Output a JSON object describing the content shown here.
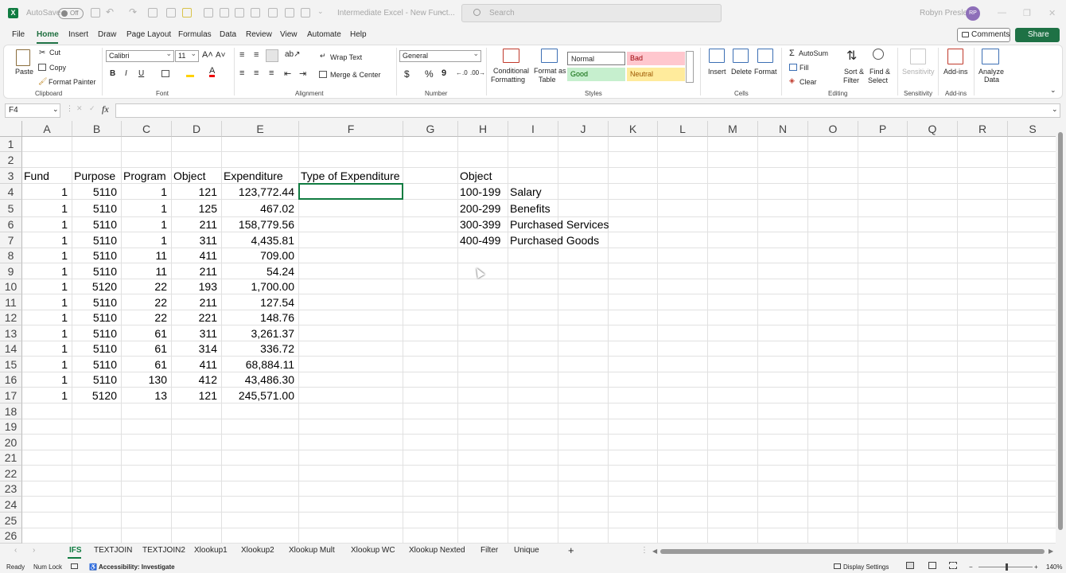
{
  "titlebar": {
    "autosave_label": "AutoSave",
    "autosave_state": "Off",
    "doc_title": "Intermediate Excel - New Funct...",
    "search_placeholder": "Search",
    "user_name": "Robyn Presley",
    "user_initials": "RP"
  },
  "menu": [
    "File",
    "Home",
    "Insert",
    "Draw",
    "Page Layout",
    "Formulas",
    "Data",
    "Review",
    "View",
    "Automate",
    "Help"
  ],
  "menu_active": "Home",
  "comments_label": "Comments",
  "share_label": "Share",
  "ribbon": {
    "clipboard": {
      "paste": "Paste",
      "cut": "Cut",
      "copy": "Copy",
      "format_painter": "Format Painter",
      "group": "Clipboard"
    },
    "font": {
      "name": "Calibri",
      "size": "11",
      "bold": "B",
      "italic": "I",
      "underline": "U",
      "group": "Font"
    },
    "alignment": {
      "wrap": "Wrap Text",
      "merge": "Merge & Center",
      "group": "Alignment"
    },
    "number": {
      "format": "General",
      "currency": "$",
      "percent": "%",
      "comma": "9",
      "group": "Number"
    },
    "styles": {
      "conditional": "Conditional",
      "conditional2": "Formatting",
      "format_as": "Format as",
      "format_as2": "Table",
      "normal": "Normal",
      "bad": "Bad",
      "good": "Good",
      "neutral": "Neutral",
      "group": "Styles"
    },
    "cells": {
      "insert": "Insert",
      "delete": "Delete",
      "format": "Format",
      "group": "Cells"
    },
    "editing": {
      "autosum": "AutoSum",
      "fill": "Fill",
      "clear": "Clear",
      "sort": "Sort &",
      "sort2": "Filter",
      "find": "Find &",
      "find2": "Select",
      "group": "Editing"
    },
    "sensitivity": {
      "label": "Sensitivity",
      "group": "Sensitivity"
    },
    "addins": {
      "label": "Add-ins",
      "group": "Add-ins"
    },
    "analyze": {
      "label": "Analyze",
      "label2": "Data"
    }
  },
  "name_box": "F4",
  "fx_label": "fx",
  "columns": [
    "A",
    "B",
    "C",
    "D",
    "E",
    "F",
    "G",
    "H",
    "I",
    "J",
    "K",
    "L",
    "M",
    "N",
    "O",
    "P",
    "Q",
    "R",
    "S"
  ],
  "rows": [
    "1",
    "2",
    "3",
    "4",
    "5",
    "6",
    "7",
    "8",
    "9",
    "10",
    "11",
    "12",
    "13",
    "14",
    "15",
    "16",
    "17",
    "18",
    "19",
    "20",
    "21",
    "22",
    "23",
    "24",
    "25",
    "26"
  ],
  "headers": {
    "fund": "Fund",
    "purpose": "Purpose",
    "program": "Program",
    "object": "Object",
    "expenditure": "Expenditure",
    "type": "Type of Expenditure"
  },
  "data_rows": [
    {
      "fund": "1",
      "purpose": "5110",
      "program": "1",
      "object": "121",
      "exp": "123,772.44"
    },
    {
      "fund": "1",
      "purpose": "5110",
      "program": "1",
      "object": "125",
      "exp": "467.02"
    },
    {
      "fund": "1",
      "purpose": "5110",
      "program": "1",
      "object": "211",
      "exp": "158,779.56"
    },
    {
      "fund": "1",
      "purpose": "5110",
      "program": "1",
      "object": "311",
      "exp": "4,435.81"
    },
    {
      "fund": "1",
      "purpose": "5110",
      "program": "11",
      "object": "411",
      "exp": "709.00"
    },
    {
      "fund": "1",
      "purpose": "5110",
      "program": "11",
      "object": "211",
      "exp": "54.24"
    },
    {
      "fund": "1",
      "purpose": "5120",
      "program": "22",
      "object": "193",
      "exp": "1,700.00"
    },
    {
      "fund": "1",
      "purpose": "5110",
      "program": "22",
      "object": "211",
      "exp": "127.54"
    },
    {
      "fund": "1",
      "purpose": "5110",
      "program": "22",
      "object": "221",
      "exp": "148.76"
    },
    {
      "fund": "1",
      "purpose": "5110",
      "program": "61",
      "object": "311",
      "exp": "3,261.37"
    },
    {
      "fund": "1",
      "purpose": "5110",
      "program": "61",
      "object": "314",
      "exp": "336.72"
    },
    {
      "fund": "1",
      "purpose": "5110",
      "program": "61",
      "object": "411",
      "exp": "68,884.11"
    },
    {
      "fund": "1",
      "purpose": "5110",
      "program": "130",
      "object": "412",
      "exp": "43,486.30"
    },
    {
      "fund": "1",
      "purpose": "5120",
      "program": "13",
      "object": "121",
      "exp": "245,571.00"
    }
  ],
  "lookup": {
    "header": "Object",
    "rows": [
      {
        "range": "100-199",
        "type": "Salary"
      },
      {
        "range": "200-299",
        "type": "Benefits"
      },
      {
        "range": "300-399",
        "type": "Purchased Services"
      },
      {
        "range": "400-499",
        "type": "Purchased Goods"
      }
    ]
  },
  "sheet_tabs": [
    "IFS",
    "TEXTJOIN",
    "TEXTJOIN2",
    "Xlookup1",
    "Xlookup2",
    "Xlookup Mult",
    "Xlookup WC",
    "Xlookup Nexted",
    "Filter",
    "Unique"
  ],
  "sheet_active": "IFS",
  "status": {
    "ready": "Ready",
    "numlock": "Num Lock",
    "accessibility": "Accessibility: Investigate",
    "display": "Display Settings",
    "zoom": "140%"
  },
  "colors": {
    "excel_green": "#107c41",
    "bad_bg": "#ffc7ce",
    "good_bg": "#c6efce",
    "neutral_bg": "#ffeb9c"
  }
}
